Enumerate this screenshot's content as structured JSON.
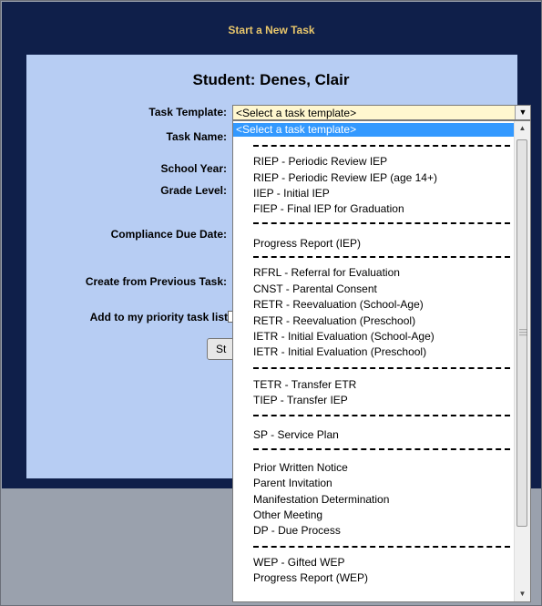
{
  "header": {
    "title": "Start a New Task"
  },
  "student": {
    "label": "Student: Denes, Clair"
  },
  "form": {
    "task_template_label": "Task Template:",
    "task_name_label": "Task Name:",
    "school_year_label": "School Year:",
    "grade_level_label": "Grade Level:",
    "compliance_due_date_label": "Compliance Due Date:",
    "create_from_previous_label": "Create from Previous Task:",
    "priority_label": "Add to my priority task list",
    "start_button_label": "St"
  },
  "template_select": {
    "value": "<Select a task template>",
    "options": [
      "<Select a task template>",
      "RIEP - Periodic Review IEP",
      "RIEP - Periodic Review IEP (age 14+)",
      "IIEP - Initial IEP",
      "FIEP - Final IEP for Graduation",
      "Progress Report (IEP)",
      "RFRL - Referral for Evaluation",
      "CNST - Parental Consent",
      "RETR - Reevaluation (School-Age)",
      "RETR - Reevaluation (Preschool)",
      "IETR - Initial Evaluation (School-Age)",
      "IETR - Initial Evaluation (Preschool)",
      "TETR - Transfer ETR",
      "TIEP - Transfer IEP",
      "SP - Service Plan",
      "Prior Written Notice",
      "Parent Invitation",
      "Manifestation Determination",
      "Other Meeting",
      "DP - Due Process",
      "WEP - Gifted WEP",
      "Progress Report (WEP)"
    ]
  },
  "icons": {
    "select_arrow": "chevron-down-icon",
    "scroll_up": "arrow-up-icon",
    "scroll_down": "arrow-down-icon"
  },
  "colors": {
    "header_bg": "#0f1f4a",
    "header_text": "#e8c66b",
    "panel_bg": "#b7cdf3",
    "select_bg": "#fff7cf",
    "selected_option": "#3399ff"
  }
}
